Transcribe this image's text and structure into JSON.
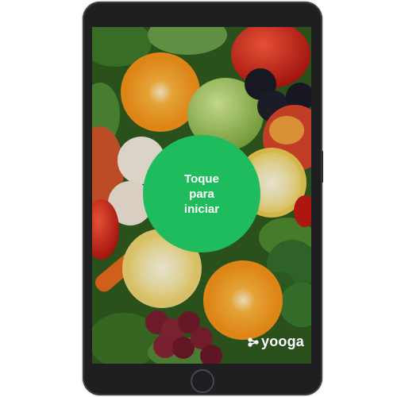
{
  "start_screen": {
    "start_label": "Toque\npara\niniciar",
    "accent_color": "#1ebc5d",
    "background": "photo of assorted fruits and vegetables (oranges, apples, berries, grapes, broccoli, leafy greens)"
  },
  "branding": {
    "logo_text": "yooga",
    "logo_icon": "yooga-logo-icon"
  },
  "device": {
    "type": "tablet",
    "home_button_icon": "home-button-icon"
  }
}
